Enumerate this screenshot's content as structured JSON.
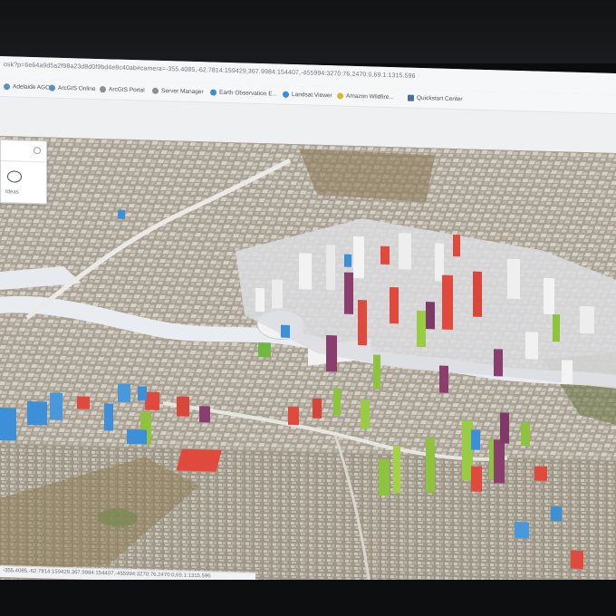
{
  "browser": {
    "url": "osk?p=6e64a9d5a2f98a23d8d0f9bd4e8c40ab#camera=-355.4085,-62.7814:159429,367.9984:154407,-455994:3270:76.2470:0,69.1:1315.596",
    "bookmarks": [
      {
        "label": "Adelaide AGOL",
        "icon": "globe-icon",
        "color": "#5b8fc7"
      },
      {
        "label": "ArcGIS Online",
        "icon": "globe-icon",
        "color": "#5b8fc7"
      },
      {
        "label": "ArcGIS Portal",
        "icon": "globe-icon",
        "color": "#8a9099"
      },
      {
        "label": "Server Manager",
        "icon": "globe-icon",
        "color": "#8a9099"
      },
      {
        "label": "Earth Observation E...",
        "icon": "globe-icon",
        "color": "#3a8fd0"
      },
      {
        "label": "Landsat Viewer",
        "icon": "globe-icon",
        "color": "#3a8fd0"
      },
      {
        "label": "Amazon Wildfire...",
        "icon": "globe-icon",
        "color": "#d8b83a"
      },
      {
        "label": "Quickstart Center",
        "icon": "arrow-icon",
        "color": "#4b6f9a"
      }
    ]
  },
  "widget": {
    "search_placeholder": "",
    "chat_label": "Ideas"
  },
  "status": {
    "coords": "-355.4085,-62.7814:159429,367.9984:154407,-455994:3270:76.2470:0,69.1:1315.596"
  },
  "colors": {
    "red": "#e04a3c",
    "green": "#8fc33e",
    "blue": "#3d8fd8",
    "purple": "#8a3e6e",
    "grey": "#e3e4e6"
  }
}
